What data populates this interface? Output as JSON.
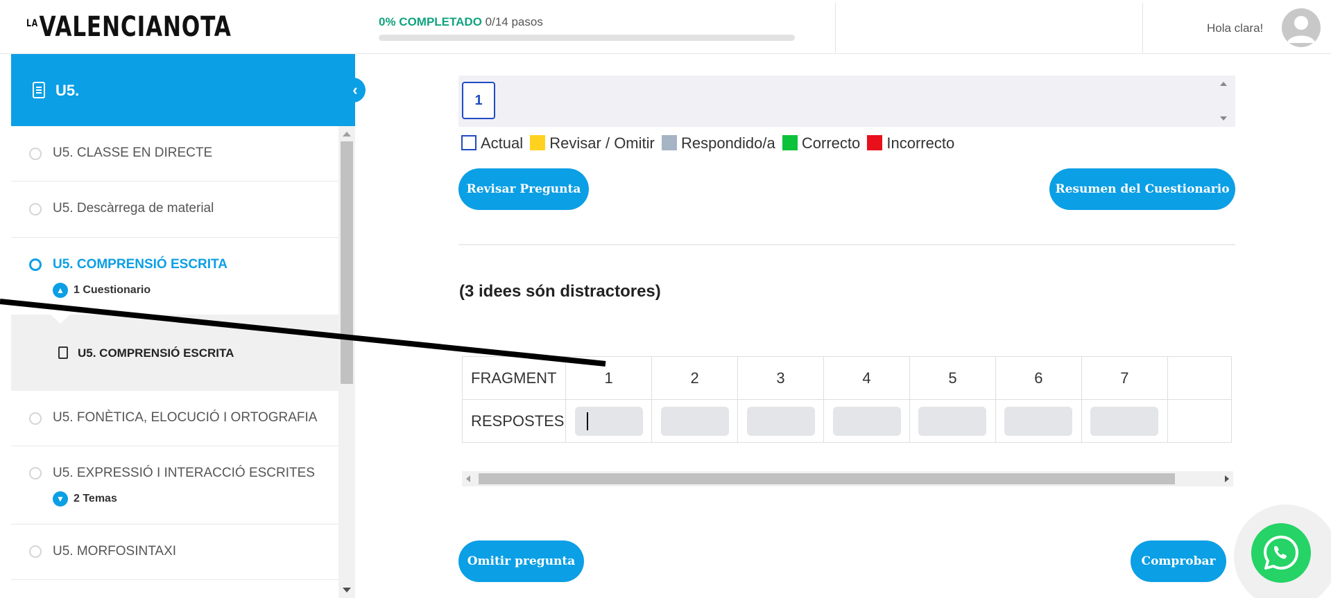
{
  "header": {
    "logo_small": "LA",
    "logo_main": "VALENCIANOTA",
    "progress_percent_label": "0% COMPLETADO",
    "progress_steps": "0/14 pasos",
    "progress_value": 0,
    "greeting": "Hola clara!"
  },
  "sidebar": {
    "title": "U5.",
    "items": [
      {
        "label": "U5. CLASSE EN DIRECTE"
      },
      {
        "label": "U5. Descàrrega de material"
      },
      {
        "label": "U5. COMPRENSIÓ ESCRITA",
        "sub": "1 Cuestionario"
      },
      {
        "label": "U5. FONÈTICA, ELOCUCIÓ I ORTOGRAFIA"
      },
      {
        "label": "U5. EXPRESSIÓ I INTERACCIÓ ESCRITES",
        "sub": "2 Temas"
      },
      {
        "label": "U5. MORFOSINTAXI"
      }
    ],
    "child": "U5. COMPRENSIÓ ESCRITA"
  },
  "quiz": {
    "current_question": "1",
    "legend": {
      "actual": "Actual",
      "review": "Revisar / Omitir",
      "answered": "Respondido/a",
      "correct": "Correcto",
      "incorrect": "Incorrecto"
    },
    "colors": {
      "actual": "#1f4bc2",
      "review": "#ffd21f",
      "answered": "#a6b4c5",
      "correct": "#0bc23a",
      "incorrect": "#e8101b",
      "accent": "#0b9fe5"
    },
    "review_button": "Revisar Pregunta",
    "summary_button": "Resumen del Cuestionario",
    "prompt": "(3 idees són distractores)",
    "table": {
      "row1_header": "FRAGMENT",
      "row2_header": "RESPOSTES",
      "columns": [
        "1",
        "2",
        "3",
        "4",
        "5",
        "6",
        "7"
      ]
    },
    "skip_button": "Omitir pregunta",
    "check_button": "Comprobar"
  }
}
